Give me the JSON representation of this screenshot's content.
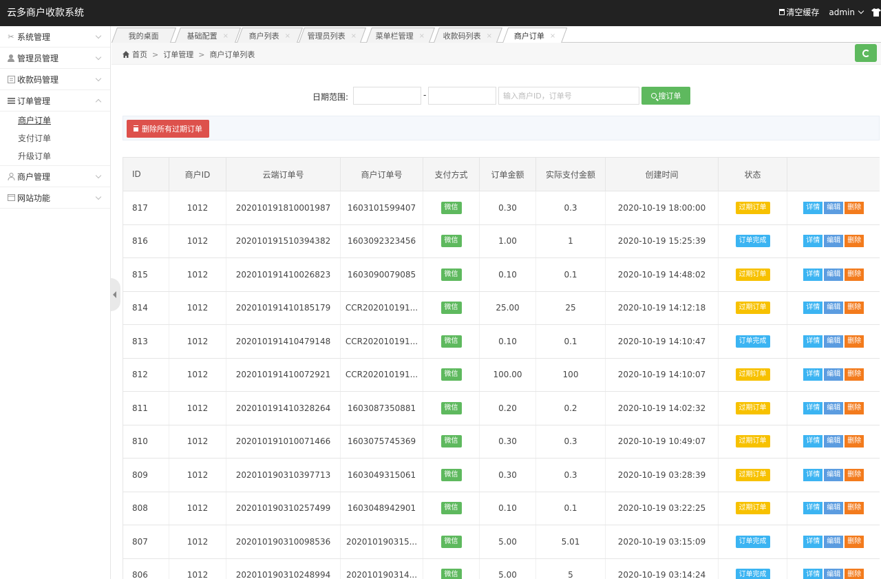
{
  "app": {
    "title": "云多商户收款系统"
  },
  "topbar": {
    "clear_cache": "清空缓存",
    "user": "admin"
  },
  "sidebar": {
    "items": [
      {
        "label": "系统管理",
        "icon": "tools-icon"
      },
      {
        "label": "管理员管理",
        "icon": "user-icon"
      },
      {
        "label": "收款码管理",
        "icon": "list-icon"
      },
      {
        "label": "订单管理",
        "icon": "menu-icon",
        "expanded": true,
        "sub": [
          "商户订单",
          "支付订单",
          "升级订单"
        ]
      },
      {
        "label": "商户管理",
        "icon": "users-icon"
      },
      {
        "label": "网站功能",
        "icon": "calendar-icon"
      }
    ]
  },
  "tabs": [
    {
      "label": "我的桌面"
    },
    {
      "label": "基础配置"
    },
    {
      "label": "商户列表"
    },
    {
      "label": "管理员列表"
    },
    {
      "label": "菜单栏管理"
    },
    {
      "label": "收款码列表"
    },
    {
      "label": "商户订单",
      "active": true
    }
  ],
  "tab_close": "×",
  "breadcrumb": {
    "home": "首页",
    "sep": ">",
    "level1": "订单管理",
    "level2": "商户订单列表"
  },
  "search": {
    "label": "日期范围:",
    "dash": "-",
    "start_value": "",
    "end_value": "",
    "keyword_placeholder": "输入商户ID，订单号",
    "button": "搜订单"
  },
  "actions": {
    "delete_expired": "删除所有过期订单"
  },
  "table": {
    "headers": [
      "ID",
      "商户ID",
      "云端订单号",
      "商户订单号",
      "支付方式",
      "订单金额",
      "实际支付金额",
      "创建时间",
      "状态",
      ""
    ],
    "op_labels": {
      "detail": "详情",
      "edit": "编辑",
      "delete": "删除"
    },
    "rows": [
      {
        "id": "817",
        "mid": "1012",
        "cloud": "202010191810001987",
        "merchant": "1603101599407",
        "pay": "微信",
        "amount": "0.30",
        "paid": "0.3",
        "time": "2020-10-19 18:00:00",
        "status": "过期订单",
        "status_type": "expired"
      },
      {
        "id": "816",
        "mid": "1012",
        "cloud": "202010191510394382",
        "merchant": "1603092323456",
        "pay": "微信",
        "amount": "1.00",
        "paid": "1",
        "time": "2020-10-19 15:25:39",
        "status": "订单完成",
        "status_type": "done"
      },
      {
        "id": "815",
        "mid": "1012",
        "cloud": "202010191410026823",
        "merchant": "1603090079085",
        "pay": "微信",
        "amount": "0.10",
        "paid": "0.1",
        "time": "2020-10-19 14:48:02",
        "status": "过期订单",
        "status_type": "expired"
      },
      {
        "id": "814",
        "mid": "1012",
        "cloud": "202010191410185179",
        "merchant": "CCR202010191...",
        "pay": "微信",
        "amount": "25.00",
        "paid": "25",
        "time": "2020-10-19 14:12:18",
        "status": "过期订单",
        "status_type": "expired"
      },
      {
        "id": "813",
        "mid": "1012",
        "cloud": "202010191410479148",
        "merchant": "CCR202010191...",
        "pay": "微信",
        "amount": "0.10",
        "paid": "0.1",
        "time": "2020-10-19 14:10:47",
        "status": "订单完成",
        "status_type": "done"
      },
      {
        "id": "812",
        "mid": "1012",
        "cloud": "202010191410072921",
        "merchant": "CCR202010191...",
        "pay": "微信",
        "amount": "100.00",
        "paid": "100",
        "time": "2020-10-19 14:10:07",
        "status": "过期订单",
        "status_type": "expired"
      },
      {
        "id": "811",
        "mid": "1012",
        "cloud": "202010191410328264",
        "merchant": "1603087350881",
        "pay": "微信",
        "amount": "0.20",
        "paid": "0.2",
        "time": "2020-10-19 14:02:32",
        "status": "过期订单",
        "status_type": "expired"
      },
      {
        "id": "810",
        "mid": "1012",
        "cloud": "202010191010071466",
        "merchant": "1603075745369",
        "pay": "微信",
        "amount": "0.30",
        "paid": "0.3",
        "time": "2020-10-19 10:49:07",
        "status": "过期订单",
        "status_type": "expired"
      },
      {
        "id": "809",
        "mid": "1012",
        "cloud": "202010190310397713",
        "merchant": "1603049315061",
        "pay": "微信",
        "amount": "0.30",
        "paid": "0.3",
        "time": "2020-10-19 03:28:39",
        "status": "过期订单",
        "status_type": "expired"
      },
      {
        "id": "808",
        "mid": "1012",
        "cloud": "202010190310257499",
        "merchant": "1603048942901",
        "pay": "微信",
        "amount": "0.10",
        "paid": "0.1",
        "time": "2020-10-19 03:22:25",
        "status": "过期订单",
        "status_type": "expired"
      },
      {
        "id": "807",
        "mid": "1012",
        "cloud": "202010190310098536",
        "merchant": "202010190315...",
        "pay": "微信",
        "amount": "5.00",
        "paid": "5.01",
        "time": "2020-10-19 03:15:09",
        "status": "订单完成",
        "status_type": "done"
      },
      {
        "id": "806",
        "mid": "1012",
        "cloud": "202010190310248994",
        "merchant": "202010190314...",
        "pay": "微信",
        "amount": "5.00",
        "paid": "5",
        "time": "2020-10-19 03:14:24",
        "status": "订单完成",
        "status_type": "done"
      }
    ]
  },
  "colors": {
    "topbar": "#222222",
    "success": "#5eb95e",
    "danger": "#dd514c",
    "warning": "#f7c100",
    "info": "#3bb4f2",
    "edit": "#5b9ce0",
    "delete": "#f37b1d"
  }
}
